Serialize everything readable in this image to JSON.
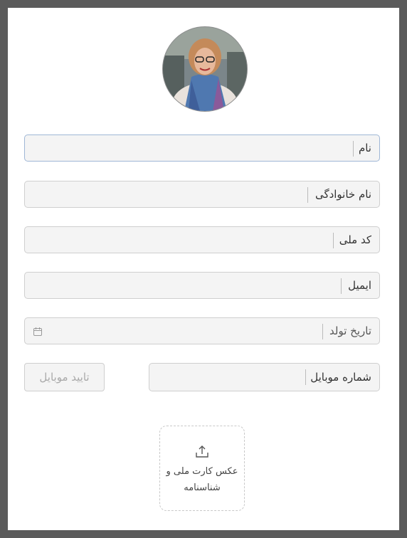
{
  "profile": {
    "avatar_icon": "profile-photo"
  },
  "form": {
    "first_name_label": "نام",
    "last_name_label": "نام خانوادگی",
    "national_code_label": "کد ملی",
    "email_label": "ایمیل",
    "birth_date_label": "تاریخ تولد",
    "birth_date_icon": "calendar-icon",
    "mobile_label": "شماره موبایل",
    "verify_mobile_button": "تایید موبایل"
  },
  "upload": {
    "icon": "upload-icon",
    "label": "عکس کارت ملی و شناسنامه"
  },
  "colors": {
    "frame": "#5b5b5b",
    "field_bg": "#f4f4f4",
    "field_border": "#cfcfcf",
    "active_border": "#9fb7d6"
  }
}
